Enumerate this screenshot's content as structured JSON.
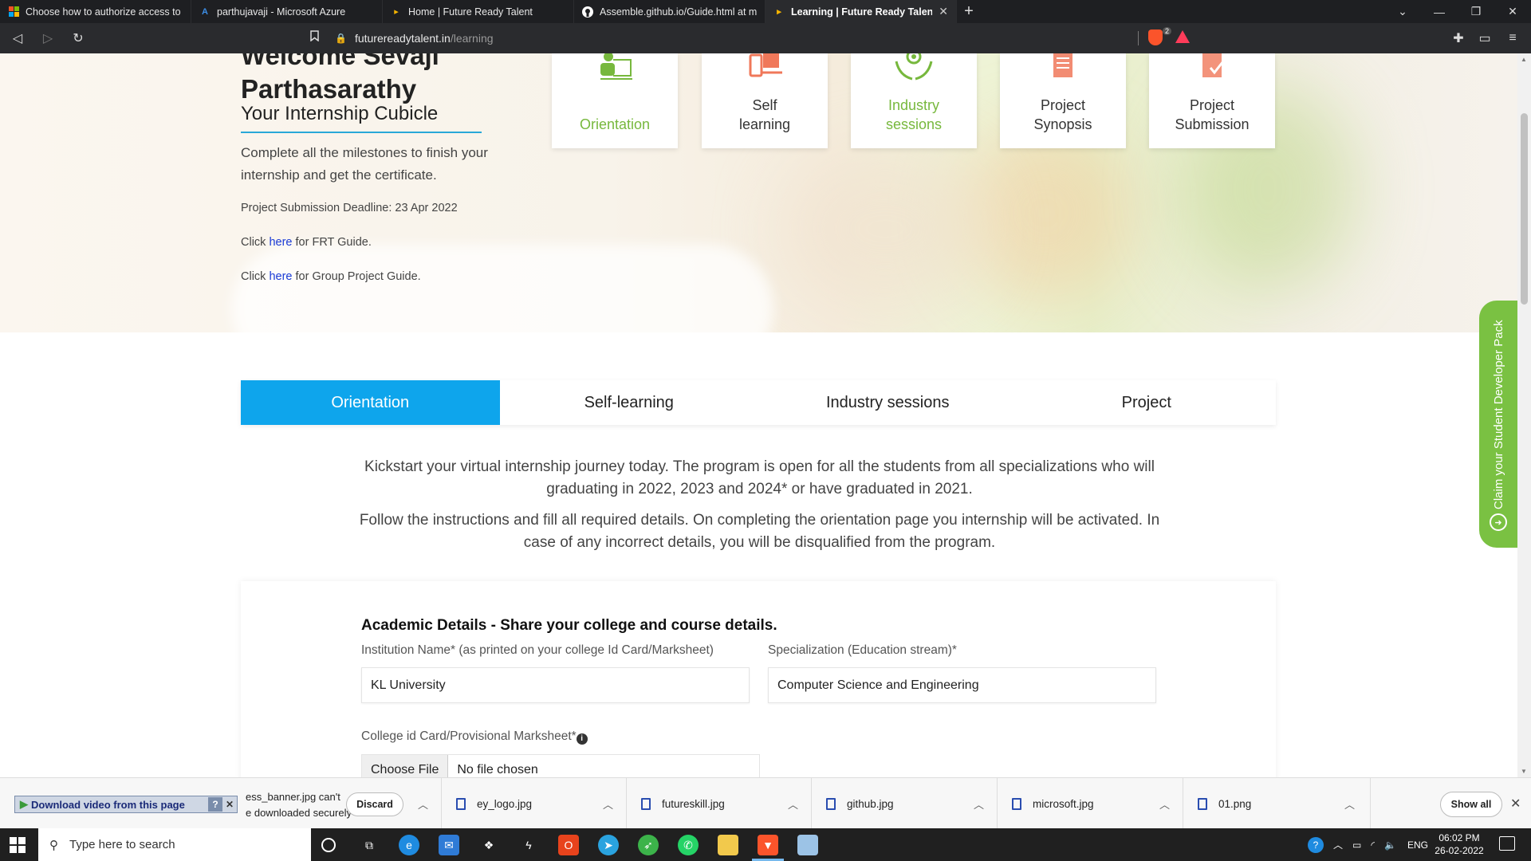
{
  "browser": {
    "tabs": [
      {
        "title": "Choose how to authorize access to blo",
        "active": false
      },
      {
        "title": "parthujavaji - Microsoft Azure",
        "active": false
      },
      {
        "title": "Home | Future Ready Talent",
        "active": false
      },
      {
        "title": "Assemble.github.io/Guide.html at mai",
        "active": false
      },
      {
        "title": "Learning | Future Ready Talent",
        "active": true
      }
    ],
    "new_tab_label": "+",
    "url_domain": "futurereadytalent.in",
    "url_path": "/learning",
    "brave_shield_count": "2"
  },
  "hero": {
    "welcome_line1": "Welcome Sevaji",
    "welcome_line2": "Parthasarathy",
    "cubicle_title": "Your Internship Cubicle",
    "intro": "Complete all the milestones to finish your internship and get the certificate.",
    "deadline": "Project Submission Deadline: 23 Apr 2022",
    "guide1_prefix": "Click ",
    "guide1_link": "here",
    "guide1_suffix": " for FRT Guide.",
    "guide2_prefix": "Click ",
    "guide2_link": "here",
    "guide2_suffix": " for Group Project Guide."
  },
  "milestones": [
    {
      "label": "Orientation",
      "done": true,
      "icon": "orientation-icon"
    },
    {
      "label": "Self learning",
      "done": false,
      "icon": "self-learning-icon"
    },
    {
      "label": "Industry sessions",
      "done": true,
      "icon": "industry-sessions-icon"
    },
    {
      "label": "Project Synopsis",
      "done": false,
      "icon": "project-synopsis-icon"
    },
    {
      "label": "Project Submission",
      "done": false,
      "icon": "project-submission-icon"
    }
  ],
  "page_tabs": [
    {
      "label": "Orientation",
      "active": true
    },
    {
      "label": "Self-learning",
      "active": false
    },
    {
      "label": "Industry sessions",
      "active": false
    },
    {
      "label": "Project",
      "active": false
    }
  ],
  "orientation": {
    "para1": "Kickstart your virtual internship journey today. The program is open for all the students from all specializations who will graduating in 2022, 2023 and 2024* or have graduated in 2021.",
    "para2": "Follow the instructions and fill all required details. On completing the orientation page you internship will be activated. In case of any incorrect details, you will be disqualified from the program."
  },
  "academic": {
    "heading": "Academic Details",
    "heading_sub": " - Share your college and course details.",
    "institution_label": "Institution Name* (as printed on your college Id Card/Marksheet)",
    "institution_value": "KL University",
    "specialization_label": "Specialization (Education stream)*",
    "specialization_value": "Computer Science and Engineering",
    "idcard_label": "College id Card/Provisional Marksheet*",
    "choose_file": "Choose File",
    "no_file": "No file chosen"
  },
  "claim_banner": {
    "label": "Claim your Student Developer Pack"
  },
  "downloads": {
    "video_helper": "Download video from this page",
    "warning_line1": "ess_banner.jpg can't",
    "warning_line2": "e downloaded securely",
    "discard": "Discard",
    "files": [
      "ey_logo.jpg",
      "futureskill.jpg",
      "github.jpg",
      "microsoft.jpg",
      "01.png"
    ],
    "show_all": "Show all"
  },
  "taskbar": {
    "search_placeholder": "Type here to search",
    "language": "ENG",
    "time": "06:02 PM",
    "date": "26-02-2022"
  },
  "colors": {
    "accent_blue": "#0ea5ec",
    "milestone_done_green": "#77b83d",
    "claim_green": "#7ac142",
    "milestone_pending_red": "#f0785a"
  }
}
